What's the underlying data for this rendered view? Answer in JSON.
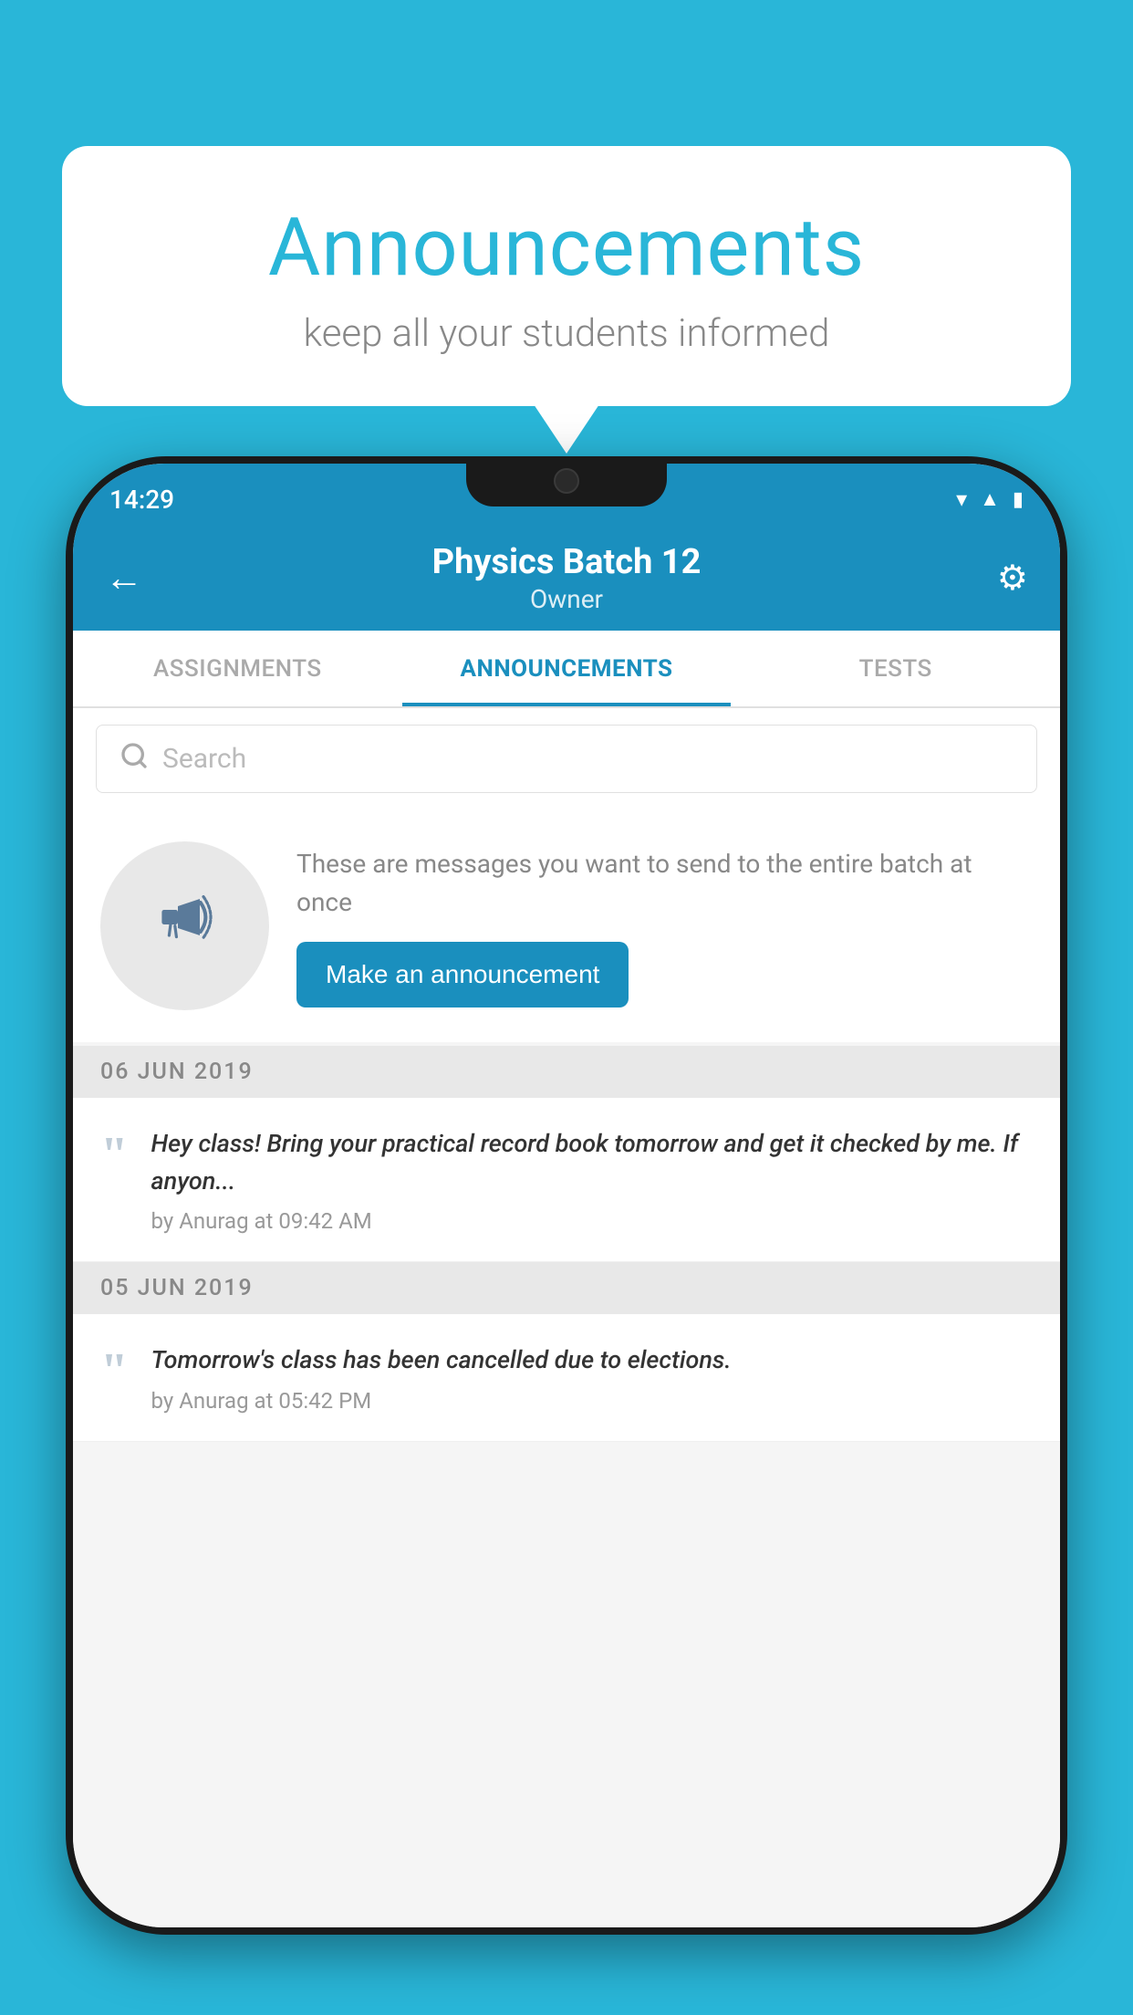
{
  "page": {
    "background_color": "#29b6d8"
  },
  "speech_bubble": {
    "title": "Announcements",
    "subtitle": "keep all your students informed"
  },
  "status_bar": {
    "time": "14:29",
    "wifi": "▲",
    "signal": "▲",
    "battery": "▮"
  },
  "header": {
    "title": "Physics Batch 12",
    "subtitle": "Owner",
    "back_label": "←",
    "settings_label": "⚙"
  },
  "tabs": [
    {
      "label": "ASSIGNMENTS",
      "active": false
    },
    {
      "label": "ANNOUNCEMENTS",
      "active": true
    },
    {
      "label": "TESTS",
      "active": false
    }
  ],
  "search": {
    "placeholder": "Search"
  },
  "announcement_prompt": {
    "description": "These are messages you want to send to the entire batch at once",
    "button_label": "Make an announcement"
  },
  "date_sections": [
    {
      "date": "06  JUN  2019",
      "items": [
        {
          "text": "Hey class! Bring your practical record book tomorrow and get it checked by me. If anyon...",
          "meta": "by Anurag at 09:42 AM"
        }
      ]
    },
    {
      "date": "05  JUN  2019",
      "items": [
        {
          "text": "Tomorrow's class has been cancelled due to elections.",
          "meta": "by Anurag at 05:42 PM"
        }
      ]
    }
  ]
}
